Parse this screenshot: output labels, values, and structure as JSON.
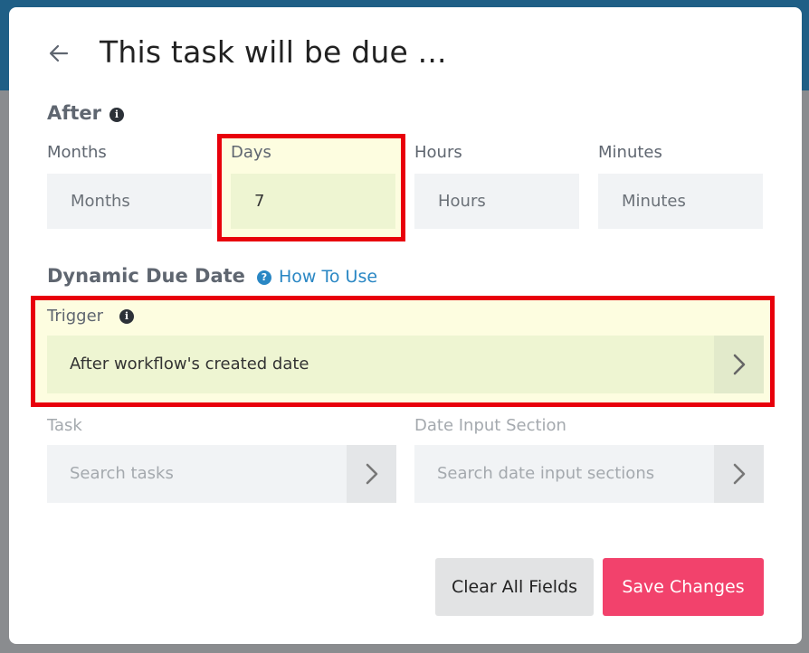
{
  "modal": {
    "title": "This task will be due ...",
    "icons": {
      "back": "arrow-left-icon",
      "info": "info-icon",
      "help": "question-circle-icon",
      "chevron": "chevron-right-icon"
    }
  },
  "after": {
    "heading": "After",
    "fields": [
      {
        "label": "Months",
        "value": "",
        "placeholder": "Months"
      },
      {
        "label": "Days",
        "value": "7",
        "placeholder": "Days"
      },
      {
        "label": "Hours",
        "value": "",
        "placeholder": "Hours"
      },
      {
        "label": "Minutes",
        "value": "",
        "placeholder": "Minutes"
      }
    ]
  },
  "dynamic": {
    "heading": "Dynamic Due Date",
    "how_to_use": "How To Use",
    "trigger_label": "Trigger",
    "trigger_value": "After workflow's created date",
    "task_label": "Task",
    "task_placeholder": "Search tasks",
    "date_input_label": "Date Input Section",
    "date_input_placeholder": "Search date input sections"
  },
  "actions": {
    "clear_label": "Clear All Fields",
    "save_label": "Save Changes"
  },
  "colors": {
    "primary": "#f2426c",
    "link": "#2a87c4",
    "highlight_border": "#e8000b",
    "highlight_fill": "#fdfde0"
  }
}
